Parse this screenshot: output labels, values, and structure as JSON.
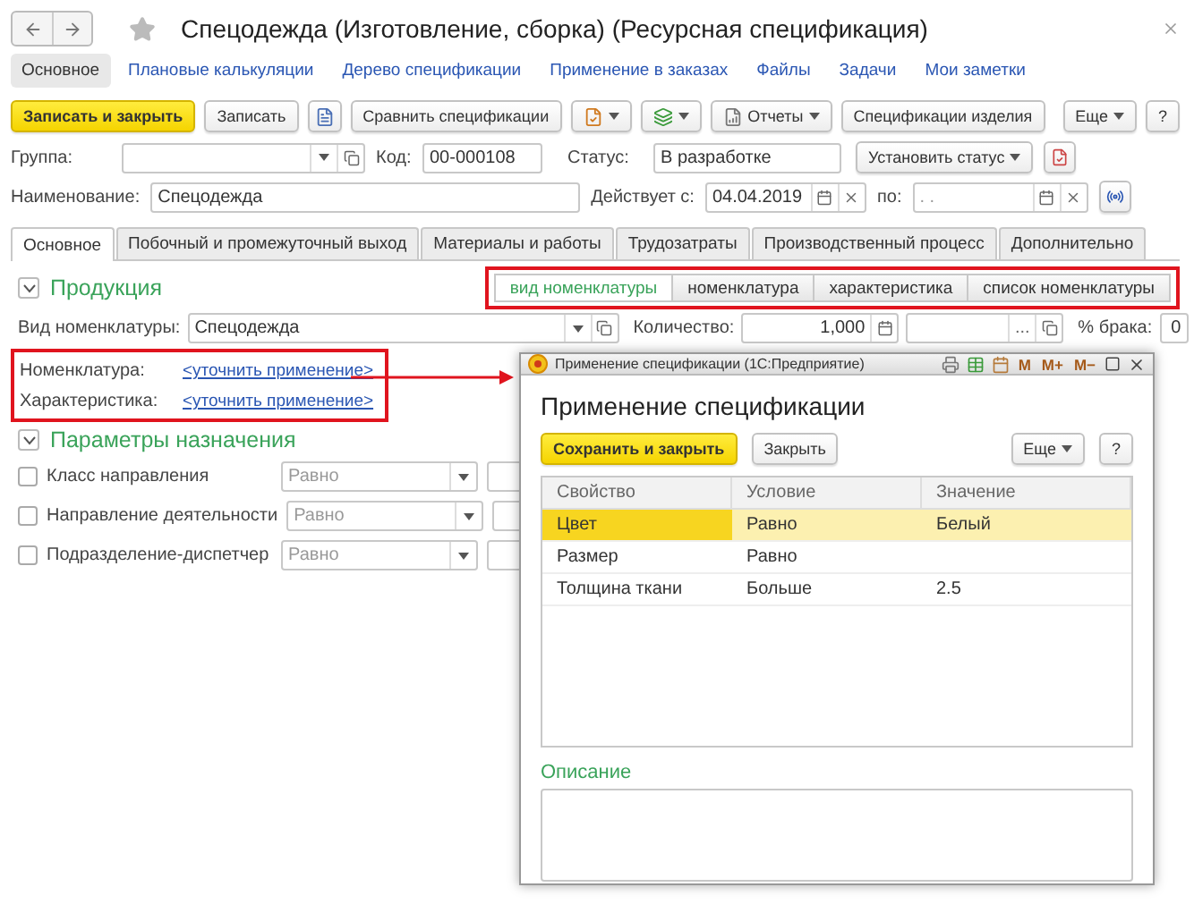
{
  "window": {
    "title": "Спецодежда (Изготовление, сборка) (Ресурсная спецификация)"
  },
  "nav_links": [
    {
      "label": "Основное",
      "selected": true
    },
    {
      "label": "Плановые калькуляции",
      "selected": false
    },
    {
      "label": "Дерево спецификации",
      "selected": false
    },
    {
      "label": "Применение в заказах",
      "selected": false
    },
    {
      "label": "Файлы",
      "selected": false
    },
    {
      "label": "Задачи",
      "selected": false
    },
    {
      "label": "Мои заметки",
      "selected": false
    }
  ],
  "toolbar": [
    {
      "kind": "primary",
      "label": "Записать и закрыть"
    },
    {
      "kind": "plain",
      "label": "Записать"
    },
    {
      "kind": "icon"
    },
    {
      "kind": "plain",
      "label": "Сравнить спецификации"
    },
    {
      "kind": "icon-menu"
    },
    {
      "kind": "icon-menu"
    },
    {
      "kind": "icon-menu",
      "label": "Отчеты"
    },
    {
      "kind": "plain",
      "label": "Спецификации изделия"
    },
    {
      "kind": "menu",
      "label": "Еще"
    },
    {
      "kind": "plain",
      "label": "?"
    }
  ],
  "group": {
    "label": "Группа:"
  },
  "code": {
    "label": "Код:",
    "value": "00-000108"
  },
  "status": {
    "label": "Статус:",
    "value": "В разработке",
    "button": "Установить статус"
  },
  "name": {
    "label": "Наименование:",
    "value": "Спецодежда"
  },
  "valid_from": {
    "label": "Действует с:",
    "value": "04.04.2019"
  },
  "valid_to": {
    "label": "по:",
    "placeholder": ".  ."
  },
  "tabs": [
    {
      "label": "Основное",
      "selected": true
    },
    {
      "label": "Побочный и промежуточный выход",
      "selected": false
    },
    {
      "label": "Материалы и работы",
      "selected": false
    },
    {
      "label": "Трудозатраты",
      "selected": false
    },
    {
      "label": "Производственный процесс",
      "selected": false
    },
    {
      "label": "Дополнительно",
      "selected": false
    }
  ],
  "production": {
    "title": "Продукция",
    "expanded": true,
    "segments": [
      {
        "label": "вид номенклатуры",
        "selected": true
      },
      {
        "label": "номенклатура",
        "selected": false
      },
      {
        "label": "характеристика",
        "selected": false
      },
      {
        "label": "список номенклатуры",
        "selected": false
      }
    ],
    "item_kind": {
      "label": "Вид номенклатуры:",
      "value": "Спецодежда"
    },
    "quantity": {
      "label": "Количество:",
      "value": "1,000"
    },
    "extra_field": {
      "select_button": "..."
    },
    "defect": {
      "label": "% брака:",
      "value": "0"
    },
    "links": [
      {
        "label": "Номенклатура:",
        "link": "<уточнить применение>"
      },
      {
        "label": "Характеристика:",
        "link": "<уточнить применение>"
      }
    ]
  },
  "assignment": {
    "title": "Параметры назначения",
    "expanded": true,
    "params": [
      {
        "label": "Класс направления",
        "checked": false,
        "condition": "Равно",
        "disabled": true
      },
      {
        "label": "Направление деятельности",
        "checked": false,
        "condition": "Равно",
        "disabled": true
      },
      {
        "label": "Подразделение-диспетчер",
        "checked": false,
        "condition": "Равно",
        "disabled": true
      }
    ]
  },
  "dialog": {
    "window_title": "Применение спецификации  (1С:Предприятие)",
    "memory_buttons": [
      "M",
      "M+",
      "M−"
    ],
    "title": "Применение спецификации",
    "buttons": [
      {
        "kind": "primary",
        "label": "Сохранить и закрыть"
      },
      {
        "kind": "plain",
        "label": "Закрыть"
      },
      {
        "kind": "menu",
        "label": "Еще"
      },
      {
        "kind": "plain",
        "label": "?"
      }
    ],
    "table": {
      "columns": [
        "Свойство",
        "Условие",
        "Значение"
      ],
      "rows": [
        {
          "cells": [
            "Цвет",
            "Равно",
            "Белый"
          ],
          "selected": true
        },
        {
          "cells": [
            "Размер",
            "Равно"
          ],
          "selected": false
        },
        {
          "cells": [
            "Толщина ткани",
            "Больше",
            "2.5"
          ],
          "selected": false
        }
      ]
    },
    "description": {
      "label": "Описание"
    }
  }
}
